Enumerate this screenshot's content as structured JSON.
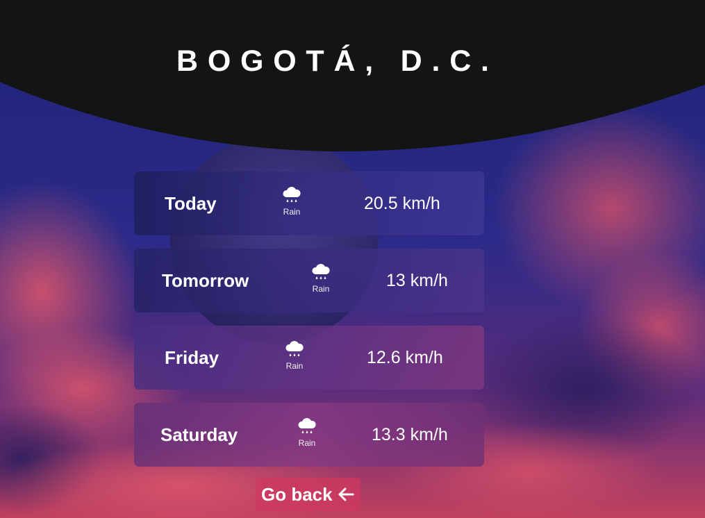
{
  "header": {
    "city": "BOGOTÁ, D.C."
  },
  "forecast": [
    {
      "day": "Today",
      "condition": "Rain",
      "wind": "20.5 km/h",
      "icon": "rain-cloud-icon"
    },
    {
      "day": "Tomorrow",
      "condition": "Rain",
      "wind": "13 km/h",
      "icon": "rain-cloud-icon"
    },
    {
      "day": "Friday",
      "condition": "Rain",
      "wind": "12.6 km/h",
      "icon": "rain-cloud-icon"
    },
    {
      "day": "Saturday",
      "condition": "Rain",
      "wind": "13.3 km/h",
      "icon": "rain-cloud-icon"
    }
  ],
  "actions": {
    "go_back_label": "Go back",
    "go_back_icon": "arrow-left-icon"
  },
  "colors": {
    "header_background": "#141414",
    "go_back_background": "#cd3860",
    "text": "#ffffff"
  }
}
